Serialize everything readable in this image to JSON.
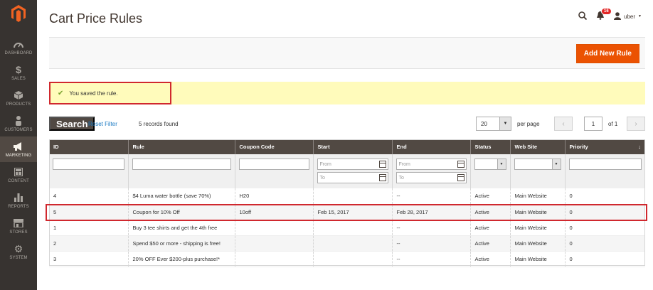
{
  "sidebar": {
    "items": [
      {
        "label": "DASHBOARD",
        "icon": "dashboard-icon"
      },
      {
        "label": "SALES",
        "icon": "dollar-icon"
      },
      {
        "label": "PRODUCTS",
        "icon": "cube-icon"
      },
      {
        "label": "CUSTOMERS",
        "icon": "person-icon"
      },
      {
        "label": "MARKETING",
        "icon": "megaphone-icon"
      },
      {
        "label": "CONTENT",
        "icon": "layout-icon"
      },
      {
        "label": "REPORTS",
        "icon": "bar-chart-icon"
      },
      {
        "label": "STORES",
        "icon": "store-icon"
      },
      {
        "label": "SYSTEM",
        "icon": "gear-icon"
      }
    ]
  },
  "header": {
    "title": "Cart Price Rules",
    "notifications": "16",
    "user": "uber"
  },
  "actions": {
    "add_new_rule": "Add New Rule"
  },
  "message": {
    "text": "You saved the rule."
  },
  "toolbar": {
    "search": "Search",
    "reset_filter": "Reset Filter",
    "records": "5 records found",
    "per_page_value": "20",
    "per_page_label": "per page",
    "page": "1",
    "of": "of 1"
  },
  "table": {
    "headers": [
      "ID",
      "Rule",
      "Coupon Code",
      "Start",
      "End",
      "Status",
      "Web Site",
      "Priority"
    ],
    "sort_indicator": "↓",
    "filters": {
      "from": "From",
      "to": "To"
    },
    "rows": [
      {
        "id": "4",
        "rule": "$4 Luma water bottle (save 70%)",
        "coupon": "H20",
        "start": "",
        "end": "--",
        "status": "Active",
        "website": "Main Website",
        "priority": "0"
      },
      {
        "id": "5",
        "rule": "Coupon for 10% Off",
        "coupon": "10off",
        "start": "Feb 15, 2017",
        "end": "Feb 28, 2017",
        "status": "Active",
        "website": "Main Website",
        "priority": "0"
      },
      {
        "id": "1",
        "rule": "Buy 3 tee shirts and get the 4th free",
        "coupon": "",
        "start": "",
        "end": "--",
        "status": "Active",
        "website": "Main Website",
        "priority": "0"
      },
      {
        "id": "2",
        "rule": "Spend $50 or more - shipping is free!",
        "coupon": "",
        "start": "",
        "end": "--",
        "status": "Active",
        "website": "Main Website",
        "priority": "0"
      },
      {
        "id": "3",
        "rule": "20% OFF Ever $200-plus purchase!*",
        "coupon": "",
        "start": "",
        "end": "--",
        "status": "Active",
        "website": "Main Website",
        "priority": "0"
      }
    ]
  },
  "colors": {
    "sidebar": "#373330",
    "accent": "#eb5202",
    "header_row": "#514943",
    "highlight": "#d0282e",
    "message_bg": "#fffbbb"
  }
}
